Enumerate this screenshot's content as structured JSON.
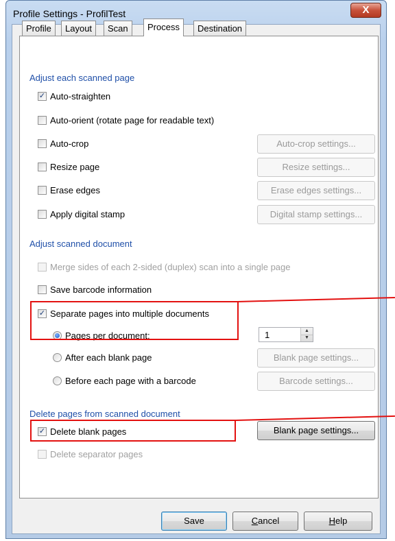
{
  "window": {
    "title": "Profile Settings - ProfilTest",
    "close_glyph": "X"
  },
  "tabs": [
    {
      "label": "Profile"
    },
    {
      "label": "Layout"
    },
    {
      "label": "Scan"
    },
    {
      "label": "Process",
      "active": true
    },
    {
      "label": "Destination"
    }
  ],
  "group1": {
    "title": "Adjust each scanned page",
    "auto_straighten": {
      "label": "Auto-straighten",
      "checked": true
    },
    "auto_orient": {
      "label": "Auto-orient (rotate page for readable text)",
      "checked": false
    },
    "auto_crop": {
      "label": "Auto-crop",
      "checked": false,
      "button": "Auto-crop settings..."
    },
    "resize": {
      "label": "Resize page",
      "checked": false,
      "button": "Resize settings..."
    },
    "erase": {
      "label": "Erase edges",
      "checked": false,
      "button": "Erase edges settings..."
    },
    "stamp": {
      "label": "Apply digital stamp",
      "checked": false,
      "button": "Digital stamp settings..."
    }
  },
  "group2": {
    "title": "Adjust scanned document",
    "merge": {
      "label": "Merge sides of each 2-sided (duplex) scan into a single page",
      "checked": false,
      "disabled": true
    },
    "barcode_info": {
      "label": "Save barcode information",
      "checked": false
    },
    "separate": {
      "label": "Separate pages into multiple documents",
      "checked": true
    },
    "pages_per_doc": {
      "label": "Pages per document:",
      "selected": true,
      "value": "1"
    },
    "after_blank": {
      "label": "After each blank page",
      "selected": false,
      "button": "Blank page settings..."
    },
    "before_barcode": {
      "label": "Before each page with a barcode",
      "selected": false,
      "button": "Barcode settings..."
    }
  },
  "group3": {
    "title": "Delete pages from scanned document",
    "delete_blank": {
      "label": "Delete blank pages",
      "checked": true,
      "button": "Blank page settings..."
    },
    "delete_separator": {
      "label": "Delete separator pages",
      "checked": false,
      "disabled": true
    }
  },
  "footer": {
    "save": "Save",
    "cancel_first": "C",
    "cancel_rest": "ancel",
    "help_first": "H",
    "help_rest": "elp"
  },
  "check_glyph": "✓",
  "colors": {
    "highlight": "#e3100f",
    "group_title": "#1f4fa8"
  }
}
